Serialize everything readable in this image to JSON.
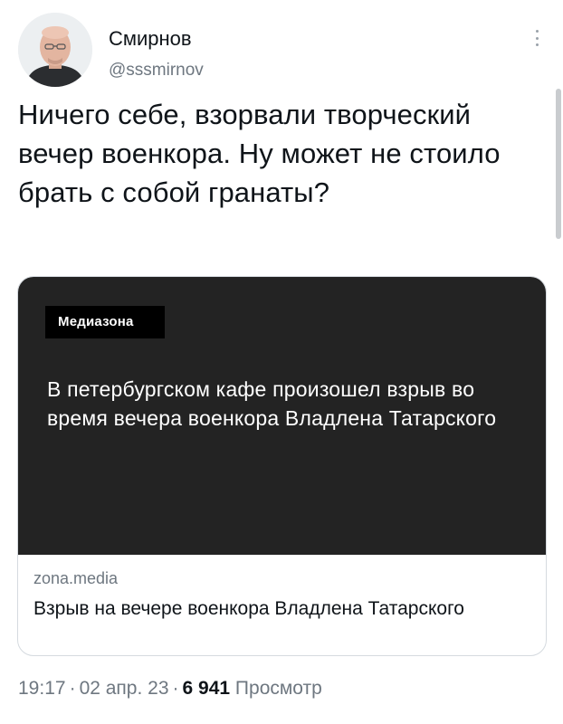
{
  "author": {
    "display_name": "Смирнов",
    "handle": "@sssmirnov",
    "avatar_icon": "profile-photo"
  },
  "tweet": {
    "text": "Ничего себе, взорвали творческий вечер военкора. Ну может не стоило брать с собой гранаты?"
  },
  "card": {
    "logo_text": "Медиазона",
    "headline": "В петербургском кафе произошел взрыв во время вечера военкора Владлена Татарского",
    "domain": "zona.media",
    "title": "Взрыв на вечере военкора Владлена Татарского"
  },
  "meta": {
    "time": "19:17",
    "date": "02 апр. 23",
    "views_count": "6 941",
    "views_label": "Просмотр",
    "separator": "·"
  },
  "colors": {
    "text": "#0f1419",
    "secondary": "#6e7780",
    "card_image_bg": "#232323",
    "border": "#d5dadf"
  },
  "icons": {
    "more": "more-vertical-icon"
  }
}
